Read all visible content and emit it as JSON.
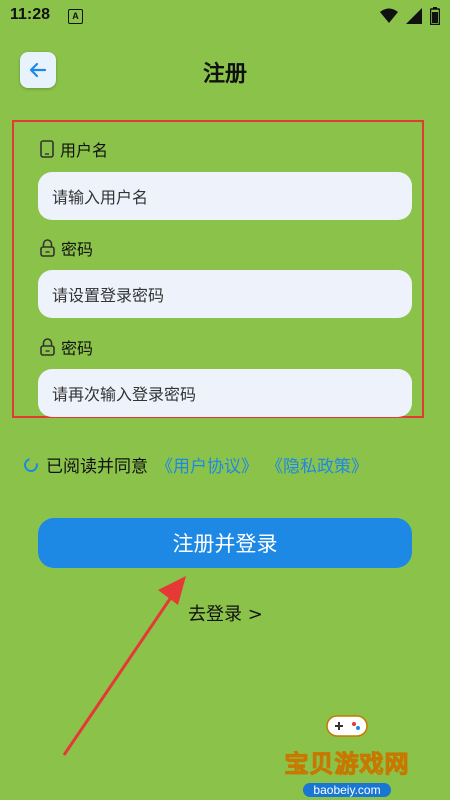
{
  "status_bar": {
    "time": "11:28",
    "notification_letter": "A"
  },
  "header": {
    "title": "注册",
    "back_icon": "arrow-left-icon"
  },
  "form": {
    "username": {
      "label": "用户名",
      "placeholder": "请输入用户名",
      "icon": "phone-icon"
    },
    "password": {
      "label": "密码",
      "placeholder": "请设置登录密码",
      "icon": "lock-icon"
    },
    "confirm_password": {
      "label": "密码",
      "placeholder": "请再次输入登录密码",
      "icon": "lock-icon"
    }
  },
  "agreement": {
    "text": "已阅读并同意",
    "user_agreement": "《用户协议》",
    "privacy_policy": "《隐私政策》"
  },
  "actions": {
    "register_button": "注册并登录",
    "login_link": "去登录 >"
  },
  "watermark": {
    "text": "宝贝游戏网",
    "url": "baobeiy.com"
  },
  "colors": {
    "background": "#8bc34a",
    "primary": "#1e88e5",
    "input_bg": "#eef3fb",
    "highlight_box": "#e53935"
  }
}
